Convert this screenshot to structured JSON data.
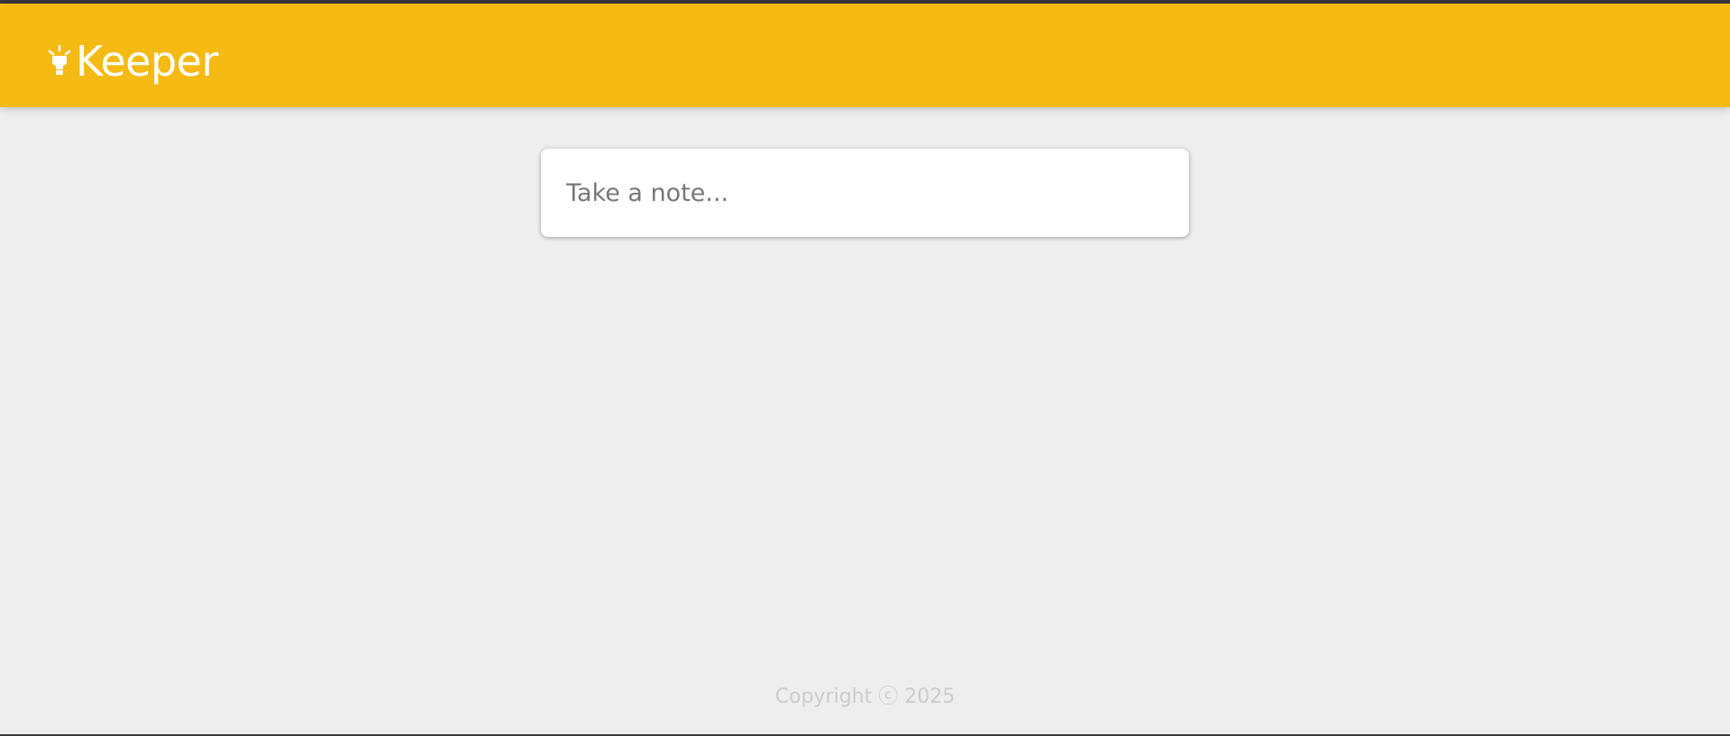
{
  "header": {
    "app_title": "Keeper",
    "logo_icon": "lightbulb-icon",
    "background_color": "#f5ba13",
    "text_color": "#ffffff"
  },
  "note_form": {
    "placeholder": "Take a note...",
    "value": ""
  },
  "footer": {
    "copyright_text": "Copyright ⓒ 2025",
    "text_color": "#cccccc"
  },
  "page": {
    "background_color": "#eeeeee"
  }
}
